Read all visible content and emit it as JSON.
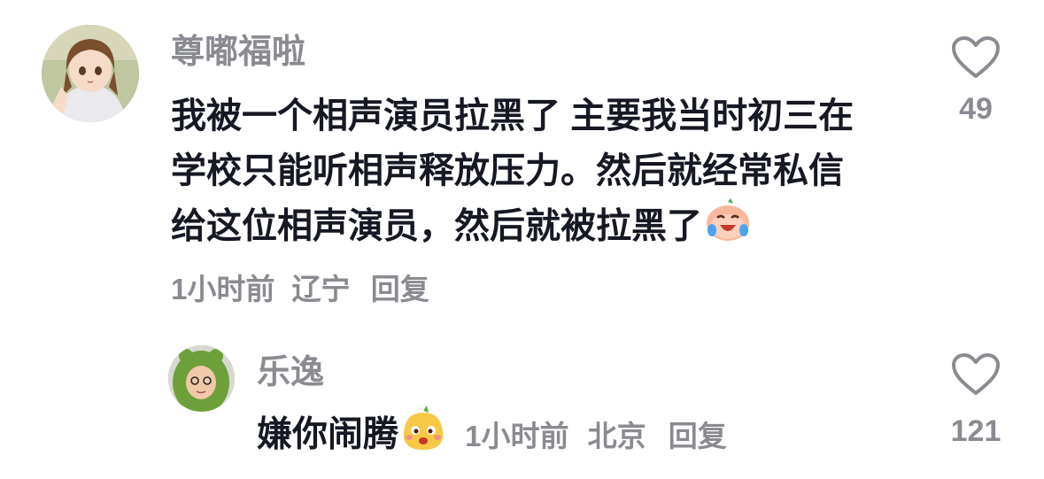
{
  "comments": [
    {
      "username": "尊嘟福啦",
      "text_lines": [
        "我被一个相声演员拉黑了 主要我当时初三在",
        "学校只能听相声释放压力。然后就经常私信",
        "给这位相声演员，然后就被拉黑了"
      ],
      "emoji": "laugh-cry-emoji",
      "time": "1小时前",
      "location": "辽宁",
      "reply_label": "回复",
      "likes": "49"
    }
  ],
  "replies": [
    {
      "username": "乐逸",
      "text": "嫌你闹腾",
      "emoji": "smug-face-emoji",
      "time": "1小时前",
      "location": "北京",
      "reply_label": "回复",
      "likes": "121"
    }
  ],
  "colors": {
    "text": "#161823",
    "meta": "#8a8b91"
  }
}
